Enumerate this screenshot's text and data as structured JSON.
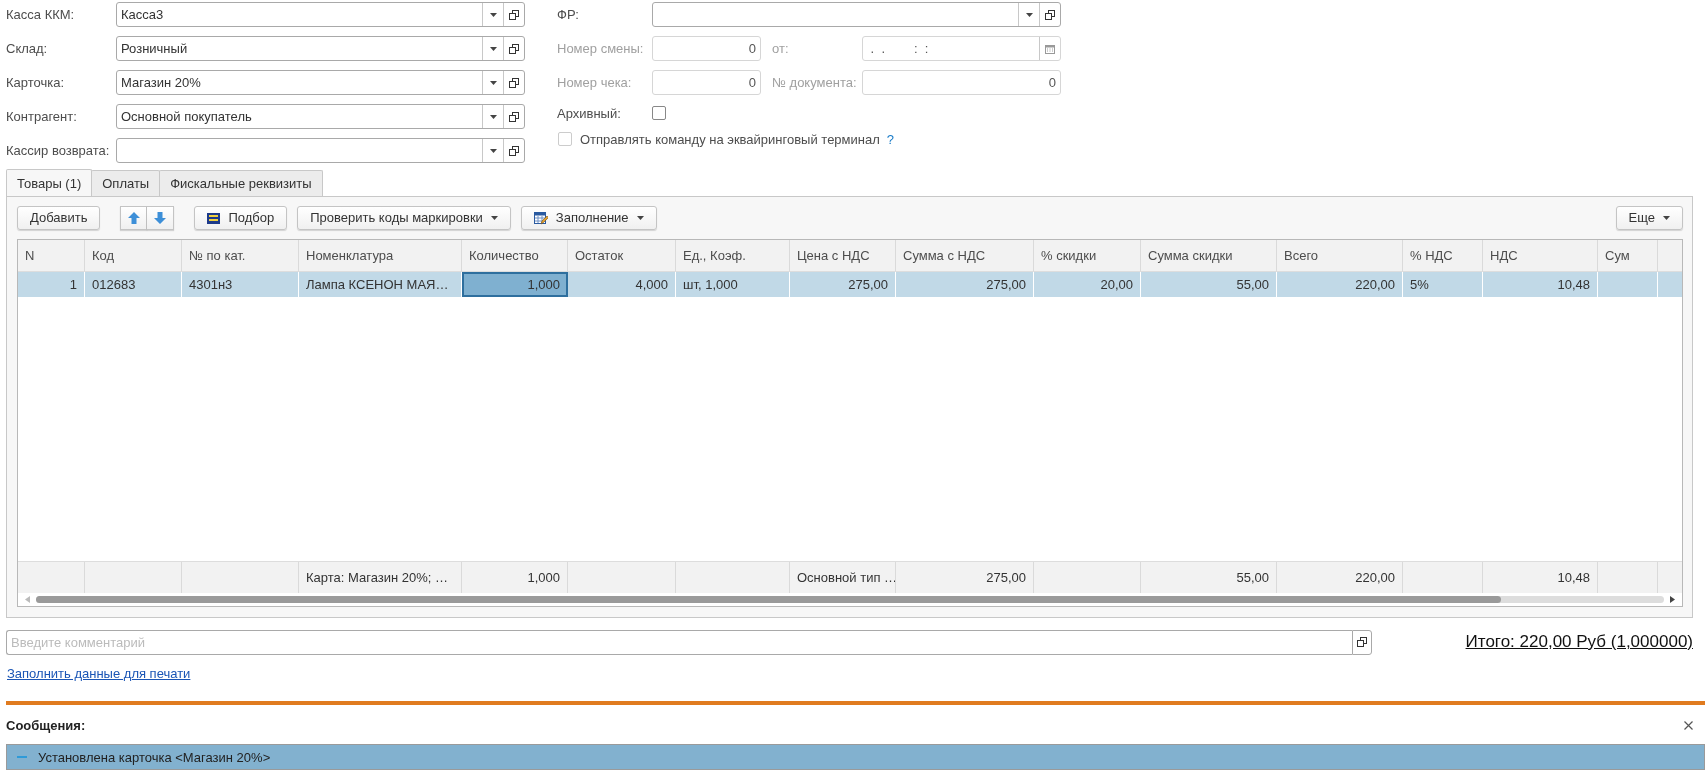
{
  "fields": [
    {
      "label": "Касса ККМ:",
      "value": "Касса3",
      "kind": "select",
      "disabled": false
    },
    {
      "label": "Склад:",
      "value": "Розничный",
      "kind": "select",
      "disabled": false
    },
    {
      "label": "Карточка:",
      "value": "Магазин 20%",
      "kind": "select",
      "disabled": false
    },
    {
      "label": "Контрагент:",
      "value": "Основной покупатель",
      "kind": "select",
      "disabled": false
    },
    {
      "label": "Кассир возврата:",
      "kind": "select",
      "disabled": false
    }
  ],
  "fr": {
    "label": "ФР:",
    "kind": "select",
    "disabled": false
  },
  "shift_number": {
    "label": "Номер  смены:",
    "value": "0",
    "kind": "number",
    "disabled": true
  },
  "shift_date": {
    "label": "от:",
    "value": " .  .        :  :",
    "kind": "date",
    "disabled": true
  },
  "receipt_number": {
    "label": "Номер чека:",
    "value": "0",
    "kind": "number",
    "disabled": true
  },
  "document_number": {
    "label": "№ документа:",
    "value": "0",
    "kind": "number",
    "disabled": true
  },
  "archived": {
    "label": "Архивный:",
    "checked": false,
    "disabled": false
  },
  "send_to_terminal": {
    "label": "Отправлять команду на эквайринговый терминал",
    "checked": false,
    "disabled": true,
    "help": "?"
  },
  "tabs": [
    {
      "label": "Товары (1)",
      "selected": true
    },
    {
      "label": "Оплаты",
      "selected": false
    },
    {
      "label": "Фискальные реквизиты",
      "selected": false
    }
  ],
  "toolbar": [
    {
      "kind": "plain",
      "label": "Добавить"
    },
    {
      "kind": "arrows"
    },
    {
      "kind": "pick",
      "label": "Подбор"
    },
    {
      "kind": "menu",
      "label": "Проверить коды маркировки"
    },
    {
      "kind": "fill_menu",
      "label": "Заполнение"
    }
  ],
  "more_button": {
    "label": "Еще"
  },
  "table": {
    "columns": [
      {
        "label": "N",
        "kind": "number"
      },
      {
        "label": "Код",
        "kind": "text"
      },
      {
        "label": "№ по кат.",
        "kind": "text"
      },
      {
        "label": "Номенклатура",
        "kind": "text"
      },
      {
        "label": "Количество",
        "kind": "number"
      },
      {
        "label": "Остаток",
        "kind": "number"
      },
      {
        "label": "Ед., Коэф.",
        "kind": "text"
      },
      {
        "label": "Цена с НДС",
        "kind": "number"
      },
      {
        "label": "Сумма с НДС",
        "kind": "number"
      },
      {
        "label": "% скидки",
        "kind": "number"
      },
      {
        "label": "Сумма скидки",
        "kind": "number"
      },
      {
        "label": "Всего",
        "kind": "number"
      },
      {
        "label": "% НДС",
        "kind": "text"
      },
      {
        "label": "НДС",
        "kind": "number"
      },
      {
        "label": "Сум",
        "kind": "text"
      }
    ],
    "rows": [
      {
        "selected": true,
        "cells": [
          {
            "text": "1",
            "focused": false
          },
          {
            "text": "012683",
            "focused": false
          },
          {
            "text": "4301н3",
            "focused": false
          },
          {
            "text": "Лампа КСЕНОН МАЯ…",
            "focused": false
          },
          {
            "text": "1,000",
            "focused": true
          },
          {
            "text": "4,000",
            "focused": false
          },
          {
            "text": "шт, 1,000",
            "focused": false
          },
          {
            "text": "275,00",
            "focused": false
          },
          {
            "text": "275,00",
            "focused": false
          },
          {
            "text": "20,00",
            "focused": false
          },
          {
            "text": "55,00",
            "focused": false
          },
          {
            "text": "220,00",
            "focused": false
          },
          {
            "text": "5%",
            "focused": false
          },
          {
            "text": "10,48",
            "focused": false
          },
          {
            "focused": false
          }
        ]
      }
    ],
    "footer": [
      {
        "kind": "empty"
      },
      {
        "kind": "empty"
      },
      {
        "kind": "empty"
      },
      {
        "text": "Карта: Магазин 20%; …",
        "kind": "text"
      },
      {
        "text": "1,000",
        "kind": "number"
      },
      {
        "kind": "empty"
      },
      {
        "kind": "empty"
      },
      {
        "text": "Основной тип …",
        "kind": "text"
      },
      {
        "text": "275,00",
        "kind": "number"
      },
      {
        "kind": "empty"
      },
      {
        "text": "55,00",
        "kind": "number"
      },
      {
        "text": "220,00",
        "kind": "number"
      },
      {
        "kind": "empty"
      },
      {
        "text": "10,48",
        "kind": "number"
      },
      {
        "kind": "empty"
      }
    ]
  },
  "comment": {
    "placeholder": "Введите комментарий"
  },
  "total": "Итого: 220,00 Руб (1,000000)",
  "print_link": "Заполнить данные для печати",
  "messages": {
    "title": "Сообщения:",
    "items": [
      {
        "text": "Установлена карточка <Магазин 20%>",
        "selected": true
      }
    ]
  }
}
